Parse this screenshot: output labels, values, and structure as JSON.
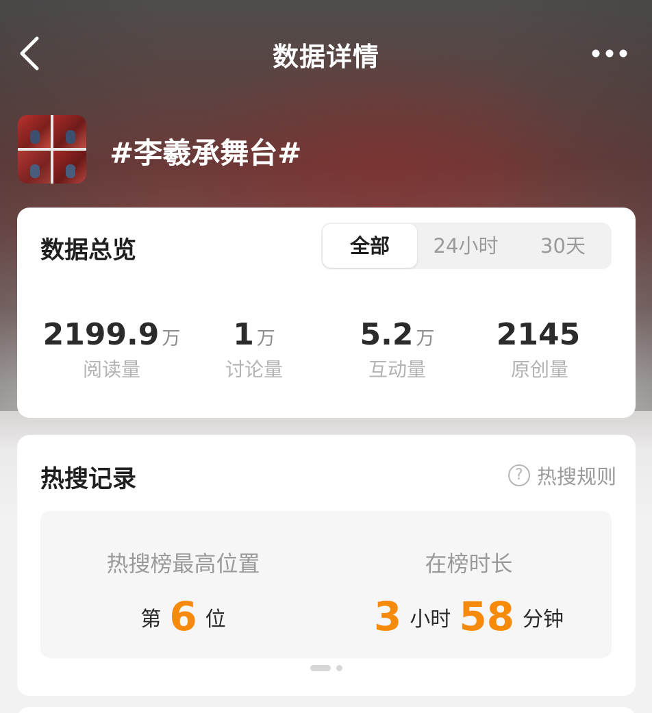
{
  "nav": {
    "title": "数据详情",
    "back_icon": "chevron-left-icon",
    "more_icon": "more-horizontal-icon"
  },
  "topic": {
    "title": "#李羲承舞台#"
  },
  "overview": {
    "heading": "数据总览",
    "tabs": [
      {
        "label": "全部",
        "active": true
      },
      {
        "label": "24小时",
        "active": false
      },
      {
        "label": "30天",
        "active": false
      }
    ],
    "stats": [
      {
        "value": "2199.9",
        "unit": "万",
        "label": "阅读量"
      },
      {
        "value": "1",
        "unit": "万",
        "label": "讨论量"
      },
      {
        "value": "5.2",
        "unit": "万",
        "label": "互动量"
      },
      {
        "value": "2145",
        "unit": "",
        "label": "原创量"
      }
    ]
  },
  "hot_search": {
    "heading": "热搜记录",
    "rules_label": "热搜规则",
    "rules_icon": "help-circle-icon",
    "peak": {
      "label": "热搜榜最高位置",
      "prefix": "第",
      "rank": "6",
      "suffix": "位"
    },
    "duration": {
      "label": "在榜时长",
      "hours": "3",
      "hours_unit": "小时",
      "minutes": "58",
      "minutes_unit": "分钟"
    },
    "pager": {
      "pages": 2,
      "current": 1
    }
  },
  "colors": {
    "accent": "#f58a0b",
    "card": "#ffffff",
    "muted_text": "#9a9a9a"
  }
}
